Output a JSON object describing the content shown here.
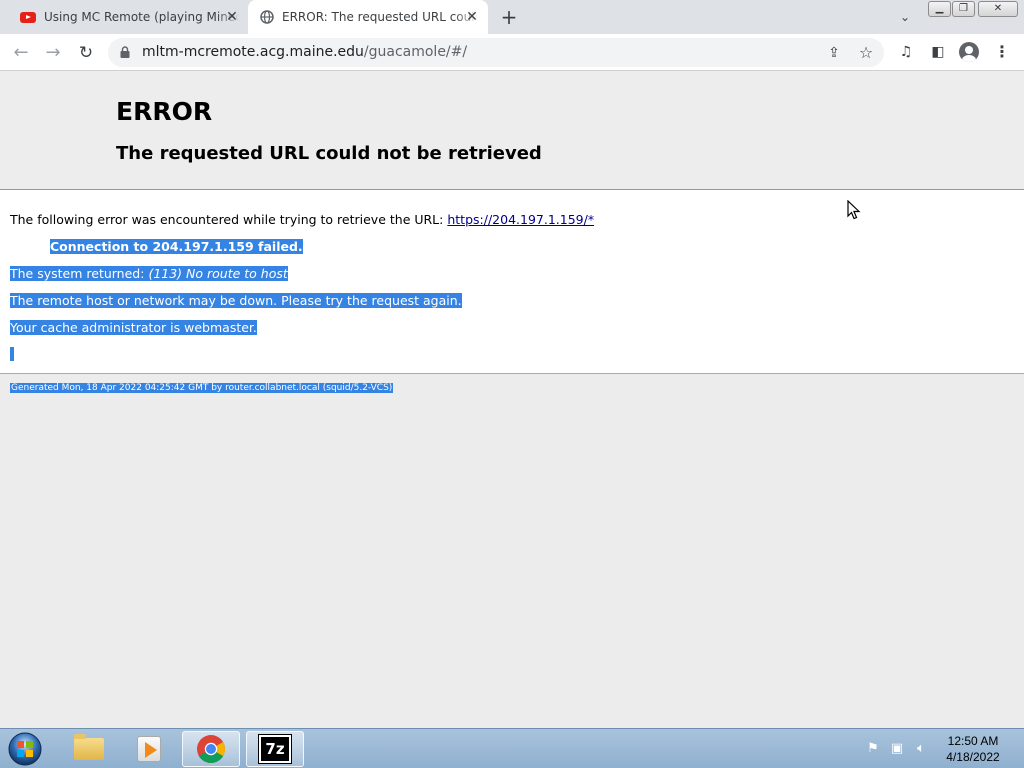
{
  "browser": {
    "tabs": [
      {
        "title": "Using MC Remote (playing Minecraft",
        "icon": "youtube-icon",
        "active": false
      },
      {
        "title": "ERROR: The requested URL could not be retrieved",
        "icon": "globe-icon",
        "active": true
      }
    ],
    "new_tab": "+",
    "address": {
      "host": "mltm-mcremote.acg.maine.edu",
      "path": "/guacamole/#/"
    }
  },
  "page": {
    "title": "ERROR",
    "subtitle": "The requested URL could not be retrieved",
    "intro": "The following error was encountered while trying to retrieve the URL:",
    "url_link": "https://204.197.1.159/*",
    "connection_failed": "Connection to 204.197.1.159 failed.",
    "system_returned_label": "The system returned:",
    "system_returned_value": "(113) No route to host",
    "remote_down": "The remote host or network may be down. Please try the request again.",
    "cache_admin_label": "Your cache administrator is",
    "cache_admin_link": "webmaster",
    "footer": "Generated Mon, 18 Apr 2022 04:25:42 GMT by router.collabnet.local (squid/5.2-VCS)"
  },
  "taskbar": {
    "apps": [
      "Windows Explorer",
      "Windows Media Player",
      "Google Chrome",
      "7-Zip"
    ],
    "clock_time": "12:50 AM",
    "clock_date": "4/18/2022"
  },
  "colors": {
    "selection": "#3584e4",
    "link": "#00008b",
    "youtube": "#e62117"
  }
}
